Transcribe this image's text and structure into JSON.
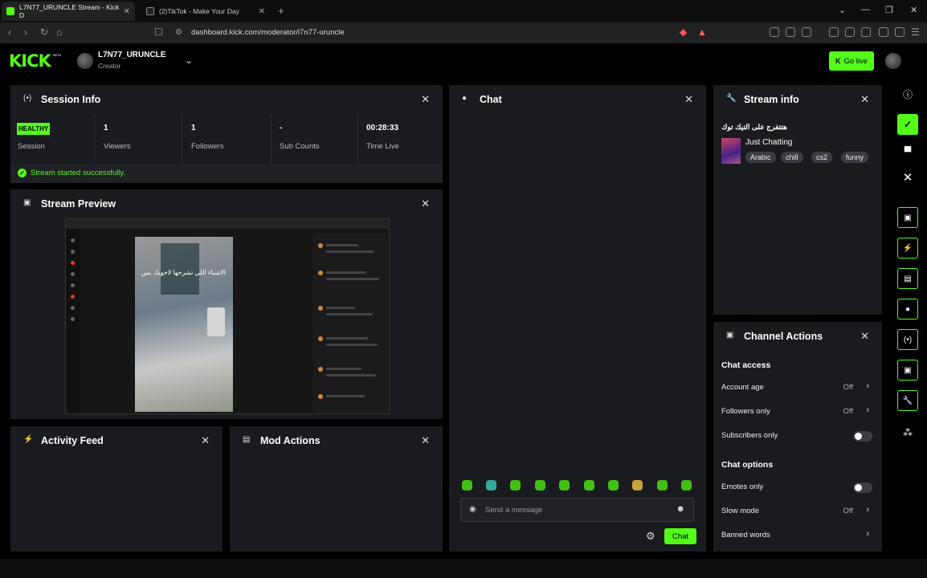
{
  "browser": {
    "tabs": [
      {
        "label": "L7N77_URUNCLE Stream - Kick D",
        "active": true
      },
      {
        "label": "(2)TikTok - Make Your Day",
        "active": false
      }
    ],
    "url": "dashboard.kick.com/moderator/l7n77-uruncle"
  },
  "header": {
    "logo": "KICK",
    "beta": "BETA",
    "channel_name": "L7N77_URUNCLE",
    "channel_role": "Creator",
    "go_live_label": "Go live"
  },
  "session_info": {
    "title": "Session Info",
    "badge": "HEALTHY",
    "stats": [
      {
        "value": "",
        "label": "Session"
      },
      {
        "value": "1",
        "label": "Viewers"
      },
      {
        "value": "1",
        "label": "Followers"
      },
      {
        "value": "-",
        "label": "Sub Counts"
      },
      {
        "value": "00:28:33",
        "label": "Time Live"
      }
    ],
    "status_message": "Stream started successfully."
  },
  "stream_preview": {
    "title": "Stream Preview",
    "caption": "الاشياء اللي تشرحها لاخويك بس"
  },
  "activity_feed": {
    "title": "Activity Feed"
  },
  "mod_actions": {
    "title": "Mod Actions"
  },
  "chat": {
    "title": "Chat",
    "input_placeholder": "Send a message",
    "send_label": "Chat"
  },
  "stream_info": {
    "title": "Stream info",
    "stream_title": "هتتفرج على التيك توك",
    "category": "Just Chatting",
    "tags": [
      "Arabic",
      "chill",
      "cs2",
      "funny"
    ]
  },
  "channel_actions": {
    "title": "Channel Actions",
    "chat_access_heading": "Chat access",
    "account_age": {
      "label": "Account age",
      "value": "Off"
    },
    "followers_only": {
      "label": "Followers only",
      "value": "Off"
    },
    "subscribers_only": {
      "label": "Subscribers only"
    },
    "chat_options_heading": "Chat options",
    "emotes_only": {
      "label": "Emotes only"
    },
    "slow_mode": {
      "label": "Slow mode",
      "value": "Off"
    },
    "banned_words": {
      "label": "Banned words"
    }
  },
  "colors": {
    "accent": "#53fc18",
    "panel": "#191b1f",
    "background": "#000000"
  }
}
